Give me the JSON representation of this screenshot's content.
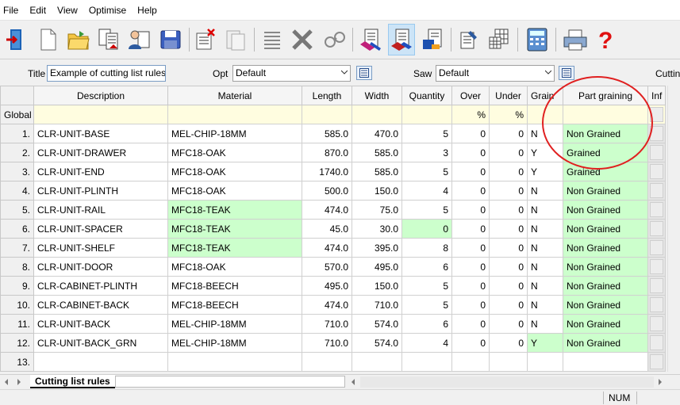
{
  "menu": {
    "items": [
      "File",
      "Edit",
      "View",
      "Optimise",
      "Help"
    ]
  },
  "options": {
    "title_label": "Title",
    "title_value": "Example of cutting list rules",
    "opt_label": "Opt",
    "opt_value": "Default",
    "saw_label": "Saw",
    "saw_value": "Default",
    "cutting_label": "Cutting"
  },
  "grid": {
    "headers": {
      "description": "Description",
      "material": "Material",
      "length": "Length",
      "width": "Width",
      "quantity": "Quantity",
      "over": "Over",
      "under": "Under",
      "grain": "Grain",
      "part_graining": "Part graining",
      "inf": "Inf"
    },
    "global": {
      "label": "Global",
      "over_unit": "%",
      "under_unit": "%"
    },
    "rows": [
      {
        "n": "1.",
        "desc": "CLR-UNIT-BASE",
        "mat": "MEL-CHIP-18MM",
        "len": "585.0",
        "wid": "470.0",
        "qty": "5",
        "over": "0",
        "under": "0",
        "grain": "N",
        "pg": "Non Grained"
      },
      {
        "n": "2.",
        "desc": "CLR-UNIT-DRAWER",
        "mat": "MFC18-OAK",
        "len": "870.0",
        "wid": "585.0",
        "qty": "3",
        "over": "0",
        "under": "0",
        "grain": "Y",
        "pg": "Grained"
      },
      {
        "n": "3.",
        "desc": "CLR-UNIT-END",
        "mat": "MFC18-OAK",
        "len": "1740.0",
        "wid": "585.0",
        "qty": "5",
        "over": "0",
        "under": "0",
        "grain": "Y",
        "pg": "Grained"
      },
      {
        "n": "4.",
        "desc": "CLR-UNIT-PLINTH",
        "mat": "MFC18-OAK",
        "len": "500.0",
        "wid": "150.0",
        "qty": "4",
        "over": "0",
        "under": "0",
        "grain": "N",
        "pg": "Non Grained"
      },
      {
        "n": "5.",
        "desc": "CLR-UNIT-RAIL",
        "mat": "MFC18-TEAK",
        "len": "474.0",
        "wid": "75.0",
        "qty": "5",
        "over": "0",
        "under": "0",
        "grain": "N",
        "pg": "Non Grained"
      },
      {
        "n": "6.",
        "desc": "CLR-UNIT-SPACER",
        "mat": "MFC18-TEAK",
        "len": "45.0",
        "wid": "30.0",
        "qty": "0",
        "over": "0",
        "under": "0",
        "grain": "N",
        "pg": "Non Grained"
      },
      {
        "n": "7.",
        "desc": "CLR-UNIT-SHELF",
        "mat": "MFC18-TEAK",
        "len": "474.0",
        "wid": "395.0",
        "qty": "8",
        "over": "0",
        "under": "0",
        "grain": "N",
        "pg": "Non Grained"
      },
      {
        "n": "8.",
        "desc": "CLR-UNIT-DOOR",
        "mat": "MFC18-OAK",
        "len": "570.0",
        "wid": "495.0",
        "qty": "6",
        "over": "0",
        "under": "0",
        "grain": "N",
        "pg": "Non Grained"
      },
      {
        "n": "9.",
        "desc": "CLR-CABINET-PLINTH",
        "mat": "MFC18-BEECH",
        "len": "495.0",
        "wid": "150.0",
        "qty": "5",
        "over": "0",
        "under": "0",
        "grain": "N",
        "pg": "Non Grained"
      },
      {
        "n": "10.",
        "desc": "CLR-CABINET-BACK",
        "mat": "MFC18-BEECH",
        "len": "474.0",
        "wid": "710.0",
        "qty": "5",
        "over": "0",
        "under": "0",
        "grain": "N",
        "pg": "Non Grained"
      },
      {
        "n": "11.",
        "desc": "CLR-UNIT-BACK",
        "mat": "MEL-CHIP-18MM",
        "len": "710.0",
        "wid": "574.0",
        "qty": "6",
        "over": "0",
        "under": "0",
        "grain": "N",
        "pg": "Non Grained"
      },
      {
        "n": "12.",
        "desc": "CLR-UNIT-BACK_GRN",
        "mat": "MEL-CHIP-18MM",
        "len": "710.0",
        "wid": "574.0",
        "qty": "4",
        "over": "0",
        "under": "0",
        "grain": "Y",
        "pg": "Non Grained"
      },
      {
        "n": "13.",
        "desc": "",
        "mat": "",
        "len": "",
        "wid": "",
        "qty": "",
        "over": "",
        "under": "",
        "grain": "",
        "pg": ""
      }
    ]
  },
  "sheet_tab": "Cutting list rules",
  "status": {
    "num": "NUM"
  },
  "colors": {
    "highlight": "#ccffcc",
    "global_row": "#fffde0",
    "annotation": "#e02020"
  },
  "toolbar_icons": [
    "exit-icon",
    "new-icon",
    "open-icon",
    "copy-list-icon",
    "customer-icon",
    "save-icon",
    "delete-icon",
    "paste-icon",
    "list-icon",
    "cut-icon",
    "glasses-icon",
    "parts-icon",
    "board-icon",
    "edge-icon",
    "edit-icon",
    "grid-icon",
    "calculator-icon",
    "print-icon",
    "help-icon"
  ]
}
